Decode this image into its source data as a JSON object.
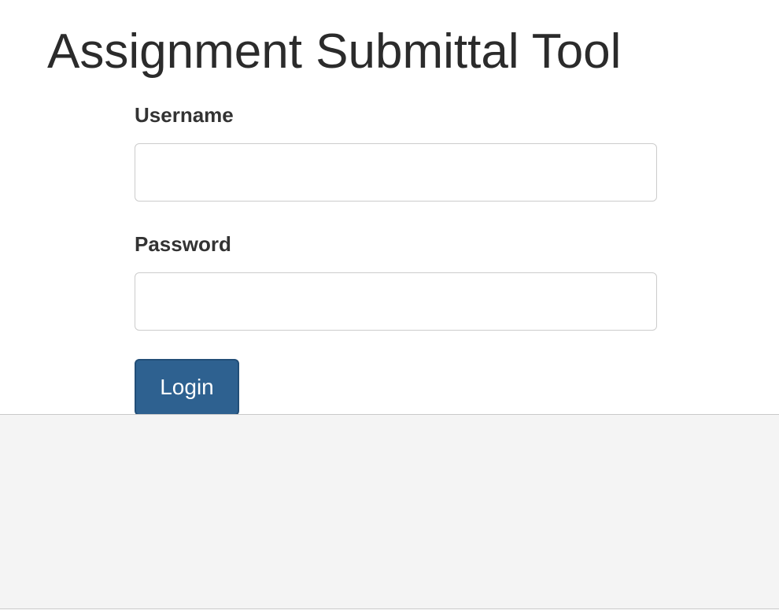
{
  "page": {
    "title": "Assignment Submittal Tool"
  },
  "login_form": {
    "username_label": "Username",
    "username_value": "",
    "password_label": "Password",
    "password_value": "",
    "login_button_label": "Login"
  },
  "colors": {
    "button_background": "#2e6190",
    "footer_background": "#f4f4f4",
    "title_text": "#2b2b2b"
  }
}
